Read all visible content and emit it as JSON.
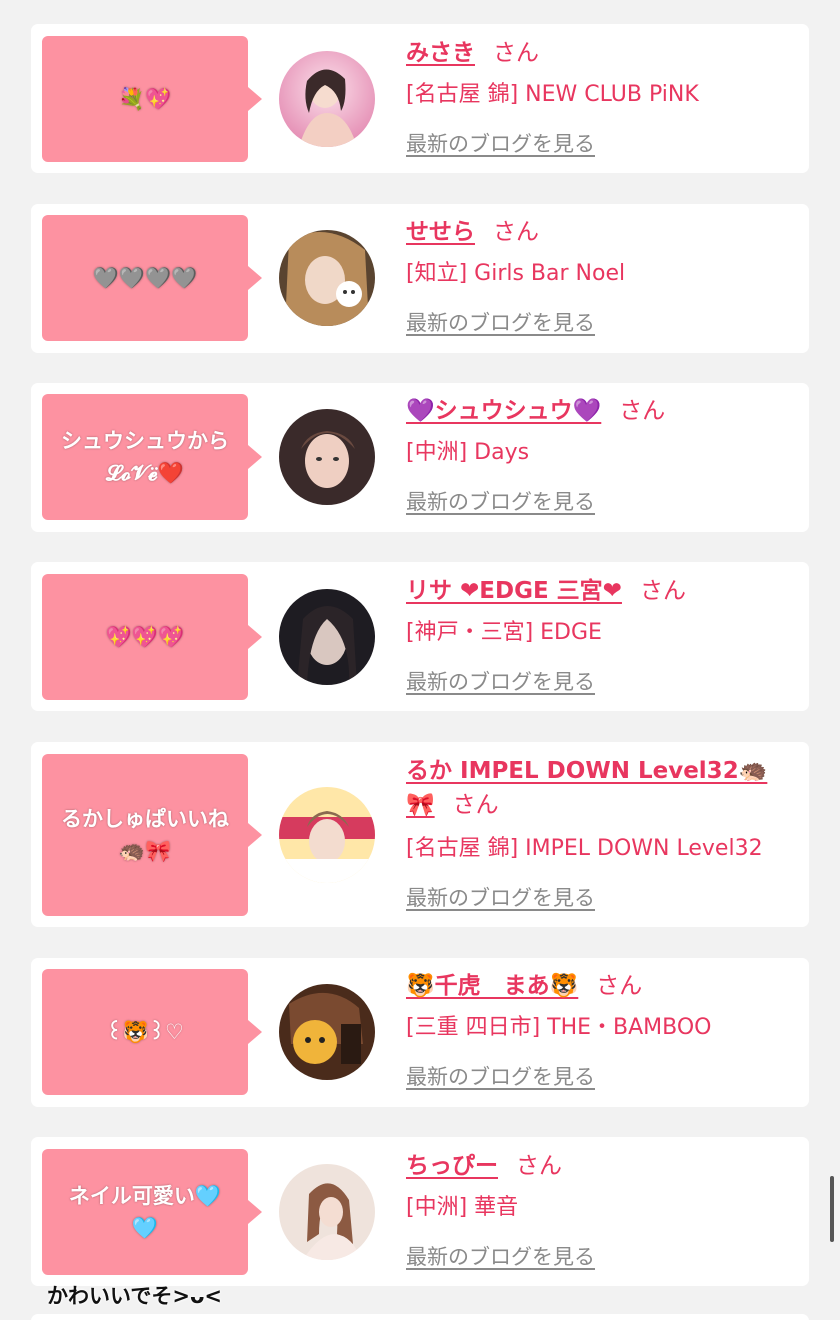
{
  "colors": {
    "accent": "#e8365f",
    "bubble": "#fd92a1",
    "link_gray": "#8a8a8a",
    "background": "#f2f2f2"
  },
  "entries": [
    {
      "bubble": "💐💖",
      "name": "みさき",
      "san": "さん",
      "shop": "[名古屋 錦] NEW CLUB PiNK",
      "blog": "最新のブログを見る",
      "avatar_colors": [
        "#f4b7cf",
        "#e58fb5"
      ]
    },
    {
      "bubble": "🩶🩶🩶🩶",
      "name": "せせら",
      "san": "さん",
      "shop": "[知立] Girls Bar Noel",
      "blog": "最新のブログを見る",
      "avatar_colors": [
        "#caa06d",
        "#5a4430"
      ]
    },
    {
      "bubble": "シュウシュウから\n𝓛𝓸𝓥𝓮̈❤️",
      "name": "💜シュウシュウ💜",
      "san": "さん",
      "shop": "[中洲] Days",
      "blog": "最新のブログを見る",
      "avatar_colors": [
        "#e6c0b3",
        "#3a2a2a"
      ]
    },
    {
      "bubble": "💖💖💖",
      "name": "リサ ❤︎EDGE 三宮❤︎",
      "san": "さん",
      "shop": "[神戸・三宮] EDGE",
      "blog": "最新のブログを見る",
      "avatar_colors": [
        "#d9c7c0",
        "#1e1c22"
      ]
    },
    {
      "bubble": "るかしゅぱいいね\n🦔🎀",
      "name": "るか IMPEL DOWN Level32🦔",
      "name_line2": "🎀",
      "san": "さん",
      "shop": "[名古屋 錦] IMPEL DOWN Level32",
      "blog": "最新のブログを見る",
      "avatar_colors": [
        "#ffe7a8",
        "#d63b5e"
      ]
    },
    {
      "bubble": "꒰🐯꒱♡",
      "name": "🐯千虎　まあ🐯",
      "san": "さん",
      "shop": "[三重 四日市] THE・BAMBOO",
      "blog": "最新のブログを見る",
      "avatar_colors": [
        "#f0b43a",
        "#4a2b1b"
      ]
    },
    {
      "bubble": "ネイル可愛い🩵\n🩵",
      "name": "ちっぴー",
      "san": "さん",
      "shop": "[中洲] 華音",
      "blog": "最新のブログを見る",
      "avatar_colors": [
        "#efe3dc",
        "#8c5a42"
      ]
    }
  ],
  "overlay_text": "かわいいでそ>ᴗ<"
}
